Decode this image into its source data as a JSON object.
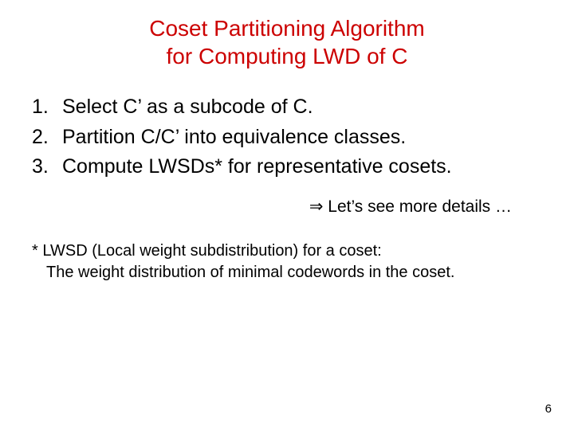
{
  "title": {
    "line1": "Coset Partitioning Algorithm",
    "line2": "for Computing LWD of C"
  },
  "steps": [
    {
      "num": "1.",
      "text": "Select C’ as a subcode of C."
    },
    {
      "num": "2.",
      "text": "Partition C/C’ into equivalence classes."
    },
    {
      "num": "3.",
      "text": "Compute LWSDs* for representative cosets."
    }
  ],
  "details": "⇒ Let’s see more details …",
  "footnote": {
    "line1": "* LWSD (Local weight subdistribution) for a coset:",
    "line2": "The weight distribution of minimal codewords in the coset."
  },
  "pageNumber": "6"
}
